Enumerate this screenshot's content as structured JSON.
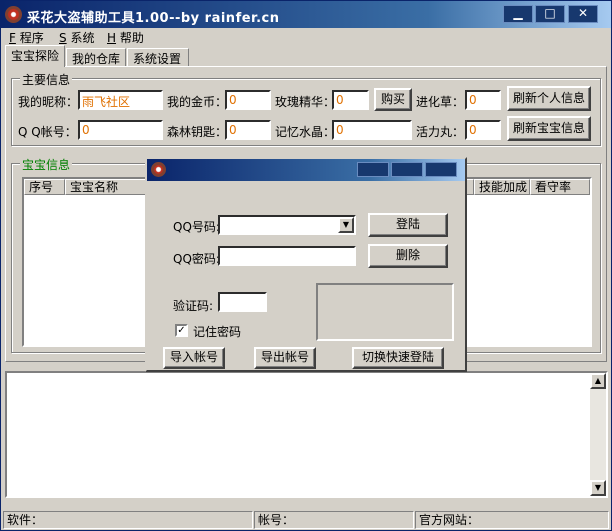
{
  "window": {
    "title": "采花大盗辅助工具1.00--by rainfer.cn",
    "minimize_glyph": "▁",
    "maximize_glyph": "□",
    "close_glyph": "✕"
  },
  "menu": [
    {
      "accel": "F",
      "label": " 程序"
    },
    {
      "accel": "S",
      "label": " 系统"
    },
    {
      "accel": "H",
      "label": " 帮助"
    }
  ],
  "tabs": [
    {
      "label": "宝宝探险"
    },
    {
      "label": "我的仓库"
    },
    {
      "label": "系统设置"
    }
  ],
  "main_info": {
    "legend": "主要信息",
    "nickname_label": "我的昵称：",
    "nickname_value": "雨飞社区",
    "gold_label": "我的金币：",
    "gold_value": "0",
    "rose_label": "玫瑰精华：",
    "rose_value": "0",
    "buy_button": "购买",
    "herb_label": "进化草：",
    "herb_value": "0",
    "refresh_personal_button": "刷新个人信息",
    "qq_label": "Q  Q帐号：",
    "qq_value": "0",
    "forest_key_label": "森林钥匙：",
    "forest_key_value": "0",
    "memory_crystal_label": "记忆水晶：",
    "memory_crystal_value": "0",
    "pill_label": "活力丸：",
    "pill_value": "0",
    "refresh_pet_button": "刷新宝宝信息"
  },
  "pet_info": {
    "legend": "宝宝信息",
    "columns": [
      "序号",
      "宝宝名称",
      "技能加成",
      "看守率"
    ]
  },
  "statusbar": {
    "software_label": "软件：",
    "account_label": "帐号：",
    "website_label": "官方网站："
  },
  "dialog": {
    "qq_label": "QQ号码:",
    "qq_value": "",
    "password_label": "QQ密码:",
    "password_value": "",
    "login_button": "登陆",
    "delete_button": "删除",
    "captcha_label": "验证码:",
    "captcha_value": "",
    "remember_label": "记住密码",
    "remember_checked": "✓",
    "import_button": "导入帐号",
    "export_button": "导出帐号",
    "quick_login_button": "切换快速登陆"
  }
}
